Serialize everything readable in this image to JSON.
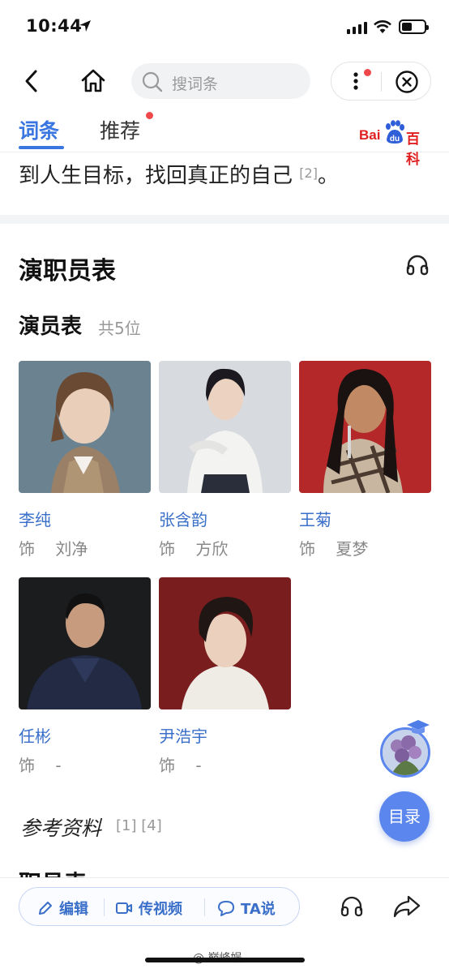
{
  "status_bar": {
    "time": "10:44"
  },
  "nav": {
    "search_placeholder": "搜词条"
  },
  "tabs": {
    "active": "词条",
    "recommend": "推荐"
  },
  "logo": {
    "bai": "Bai",
    "du": "du",
    "baike": "百科"
  },
  "content": {
    "intro_text": "到人生目标，找回真正的自己",
    "intro_ref": "[2]",
    "intro_tail": "。",
    "section_title": "演职员表",
    "subsection_title": "演员表",
    "subsection_count": "共5位",
    "cast": [
      {
        "name": "李纯",
        "role": "饰    刘净"
      },
      {
        "name": "张含韵",
        "role": "饰    方欣"
      },
      {
        "name": "王菊",
        "role": "饰    夏梦"
      },
      {
        "name": "任彬",
        "role": "饰    -"
      },
      {
        "name": "尹浩宇",
        "role": "饰    -"
      }
    ],
    "refs_title": "参考资料",
    "refs_nums": "[1] [4]",
    "partial_title": "职员表"
  },
  "floating": {
    "toc_label": "目录"
  },
  "bottom_bar": {
    "edit": "编辑",
    "video": "传视频",
    "ta_say": "TA说"
  },
  "watermark": "@ 巅峰娱"
}
